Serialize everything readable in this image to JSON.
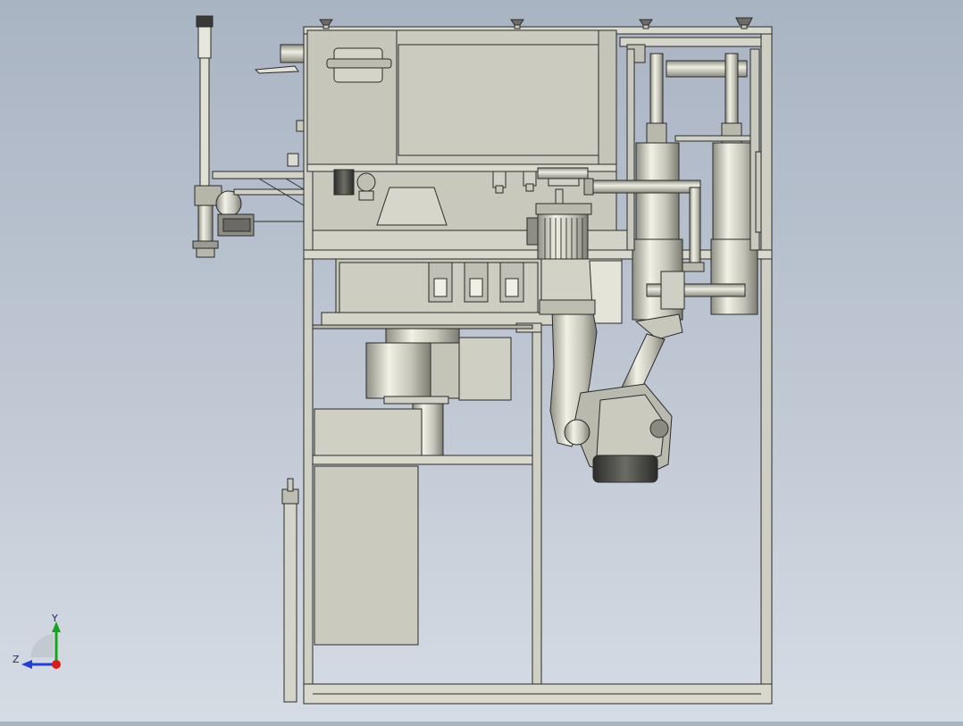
{
  "viewport": {
    "background_top": "#a9b4c3",
    "background_bottom": "#d6dce4",
    "model_fill": "#c9c9bd",
    "model_stroke": "#2b2b2b"
  },
  "triad": {
    "y_label": "Y",
    "z_label": "Z",
    "y_color": "#17a51c",
    "z_color": "#1f3fd8",
    "x_color": "#e01818"
  }
}
